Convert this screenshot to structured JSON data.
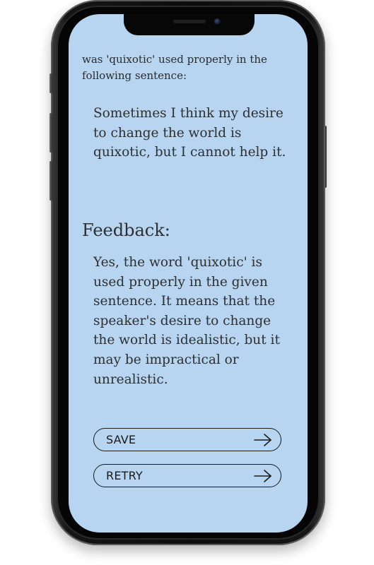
{
  "question": {
    "text": "was 'quixotic' used properly in the following sentence:"
  },
  "sentence": {
    "text": "Sometimes I think my desire to change the world is quixotic, but I cannot help it."
  },
  "feedback": {
    "title": "Feedback:",
    "body": "Yes, the word 'quixotic' is used properly in the given sentence. It means that the speaker's desire to change the world is idealistic, but it may be impractical or unrealistic."
  },
  "actions": {
    "save_label": "SAVE",
    "retry_label": "RETRY",
    "arrow_icon": "arrow-right-icon"
  },
  "colors": {
    "screen_background": "#b7d5f1",
    "text": "#2f2f2f",
    "button_border": "#1a1a1a",
    "phone_frame": "#0d0d0d"
  }
}
